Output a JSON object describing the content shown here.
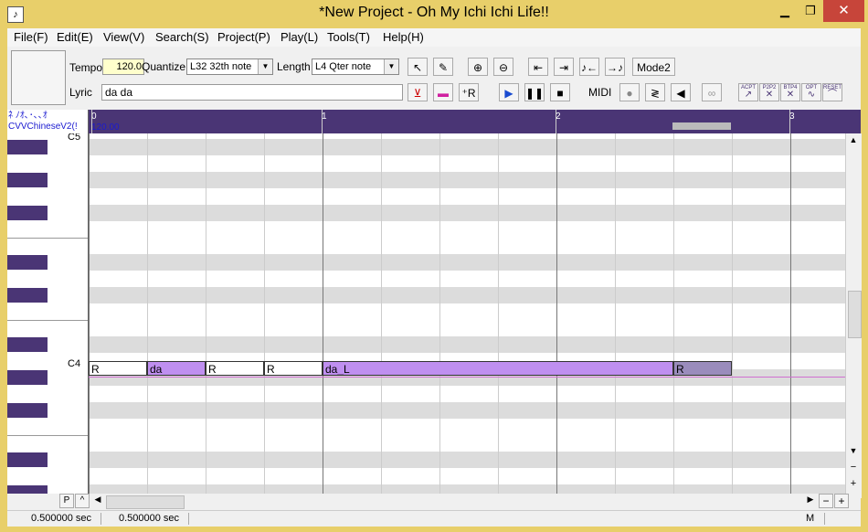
{
  "window": {
    "title": "*New Project - Oh My Ichi Ichi Life!!",
    "app_icon": "♪",
    "min_icon": "▁",
    "max_icon": "❐",
    "close_icon": "✕"
  },
  "menu": [
    "File(F)",
    "Edit(E)",
    "View(V)",
    "Search(S)",
    "Project(P)",
    "Play(L)",
    "Tools(T)",
    "Help(H)"
  ],
  "toolbar": {
    "tempo_label": "Tempo",
    "tempo_value": "120.0",
    "quantize_label": "Quantize",
    "quantize_value": "L32  32th note",
    "length_label": "Length",
    "length_value": "L4   Qter note",
    "lyric_label": "Lyric",
    "lyric_value": "da da",
    "mode2_label": "Mode2",
    "midi_label": "MIDI",
    "mini_labels": [
      "ACPT",
      "P2P2",
      "BTP4",
      "OPT",
      "RESET"
    ]
  },
  "track": {
    "singer": "ﾈ ﾉｵ､･､､ｵ",
    "singer_line2": "CVVChineseV2(!",
    "tempo_marker": "120.00"
  },
  "ruler": {
    "ticks": [
      "0",
      "1",
      "2",
      "3"
    ]
  },
  "piano": {
    "c5_label": "C5",
    "c4_label": "C4"
  },
  "notes": [
    {
      "lyric": "R"
    },
    {
      "lyric": "da"
    },
    {
      "lyric": "R"
    },
    {
      "lyric": "R"
    },
    {
      "lyric": "da_L"
    },
    {
      "lyric": "R"
    }
  ],
  "hscroll": {
    "p_label": "P",
    "caret_label": "^",
    "left_arrow": "◀",
    "right_arrow": "▶",
    "minus_label": "−",
    "plus_label": "+"
  },
  "vscroll": {
    "up_arrow": "▲",
    "down_arrow": "▼",
    "minus_label": "−",
    "plus_label": "+"
  },
  "status": {
    "time1": "0.500000 sec",
    "time2": "0.500000 sec",
    "mode": "M"
  }
}
